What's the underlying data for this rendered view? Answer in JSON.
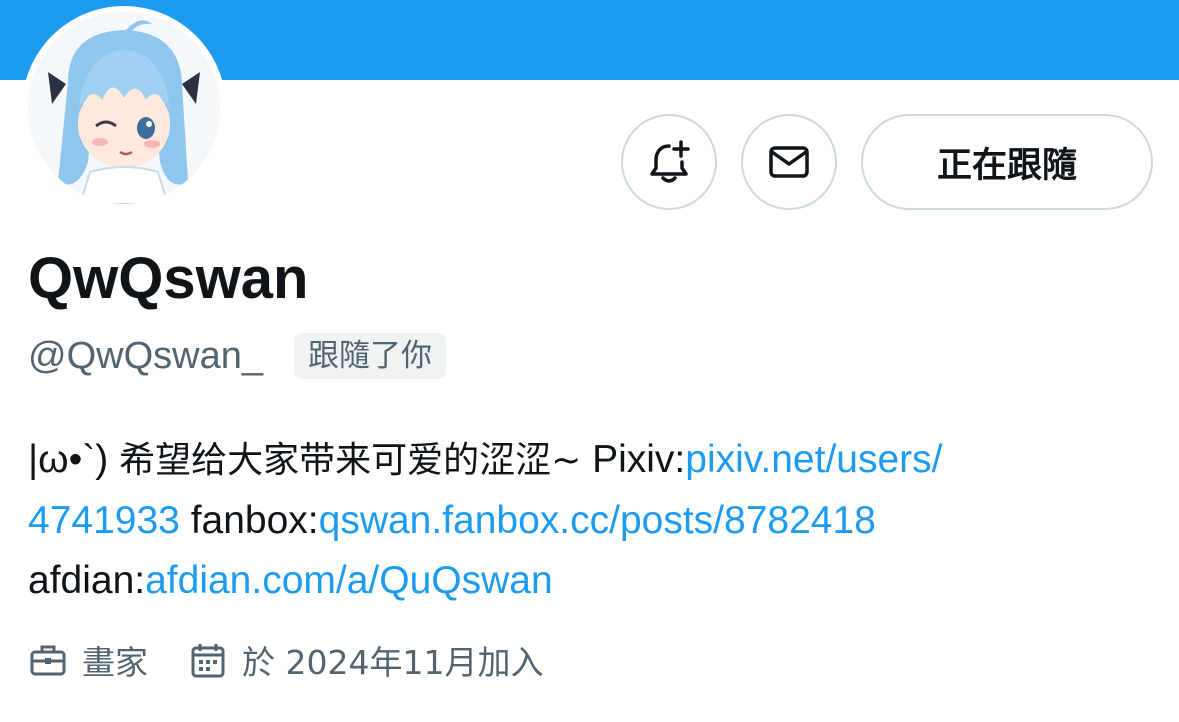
{
  "colors": {
    "banner": "#1d9bf0",
    "link": "#1d9bf0",
    "secondary_text": "#536471",
    "border": "#cfd9de"
  },
  "actions": {
    "notify_icon": "bell-plus-icon",
    "message_icon": "envelope-icon",
    "follow_label": "正在跟隨"
  },
  "profile": {
    "display_name": "QwQswan",
    "handle": "@QwQswan_",
    "follows_you_badge": "跟隨了你",
    "bio": {
      "emoticon": "|ω•`)",
      "text": "希望给大家带来可爱的涩涩~",
      "pixiv_label": "Pixiv:",
      "pixiv_link_line1": "pixiv.net/users/",
      "pixiv_link_line2": "4741933",
      "fanbox_label": "fanbox:",
      "fanbox_link": "qswan.fanbox.cc/posts/8782418",
      "afdian_label": "afdian:",
      "afdian_link": "afdian.com/a/QuQswan"
    },
    "profession": "畫家",
    "profession_icon": "briefcase-icon",
    "joined": "於 2024年11月加入",
    "joined_icon": "calendar-icon"
  }
}
